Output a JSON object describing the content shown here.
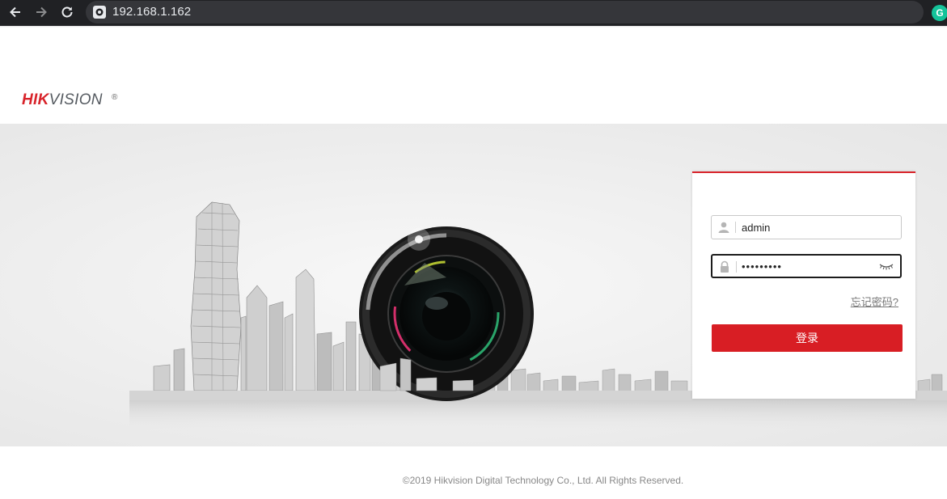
{
  "browser": {
    "url": "192.168.1.162",
    "extension_badge": "G",
    "icons": [
      "back-icon",
      "forward-icon",
      "reload-icon",
      "site-info-icon",
      "grammarly-icon"
    ]
  },
  "header": {
    "logo_part1": "HIK",
    "logo_part2": "VISION",
    "logo_mark": "®"
  },
  "login": {
    "username_value": "admin",
    "password_mask": "•••••••••",
    "forgot_password": "忘记密码?",
    "login_button": "登录",
    "accent_color": "#d8232a",
    "icons": [
      "user-icon",
      "lock-icon",
      "eye-icon"
    ]
  },
  "footer": {
    "copyright": "©2019 Hikvision Digital Technology Co., Ltd. All Rights Reserved."
  }
}
